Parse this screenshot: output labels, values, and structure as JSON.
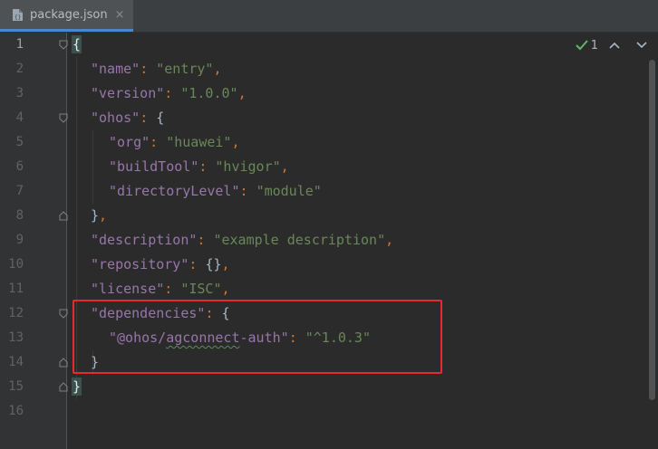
{
  "tab": {
    "file_name": "package.json",
    "close_glyph": "×"
  },
  "inspection": {
    "count": "1"
  },
  "line_numbers": [
    "1",
    "2",
    "3",
    "4",
    "5",
    "6",
    "7",
    "8",
    "9",
    "10",
    "11",
    "12",
    "13",
    "14",
    "15",
    "16"
  ],
  "code": {
    "l1": {
      "brace": "{"
    },
    "l2": {
      "key": "\"name\"",
      "colon": ": ",
      "value": "\"entry\"",
      "comma": ","
    },
    "l3": {
      "key": "\"version\"",
      "colon": ": ",
      "value": "\"1.0.0\"",
      "comma": ","
    },
    "l4": {
      "key": "\"ohos\"",
      "colon": ": ",
      "brace": "{"
    },
    "l5": {
      "key": "\"org\"",
      "colon": ": ",
      "value": "\"huawei\"",
      "comma": ","
    },
    "l6": {
      "key": "\"buildTool\"",
      "colon": ": ",
      "value": "\"hvigor\"",
      "comma": ","
    },
    "l7": {
      "key": "\"directoryLevel\"",
      "colon": ": ",
      "value": "\"module\""
    },
    "l8": {
      "brace": "}",
      "comma": ","
    },
    "l9": {
      "key": "\"description\"",
      "colon": ": ",
      "value": "\"example description\"",
      "comma": ","
    },
    "l10": {
      "key": "\"repository\"",
      "colon": ": ",
      "braces": "{}",
      "comma": ","
    },
    "l11": {
      "key": "\"license\"",
      "colon": ": ",
      "value": "\"ISC\"",
      "comma": ","
    },
    "l12": {
      "key": "\"dependencies\"",
      "colon": ": ",
      "brace": "{"
    },
    "l13": {
      "key_pre": "\"@ohos/",
      "key_squiggle": "agconnect",
      "key_post": "-auth\"",
      "colon": ": ",
      "value": "\"^1.0.3\""
    },
    "l14": {
      "brace": "}"
    },
    "l15": {
      "brace": "}"
    }
  },
  "colors": {
    "background": "#2b2b2b",
    "gutter": "#313335",
    "key": "#9876aa",
    "string": "#6a8759",
    "punctuation": "#cc7832",
    "highlight_box": "#e8292f"
  }
}
